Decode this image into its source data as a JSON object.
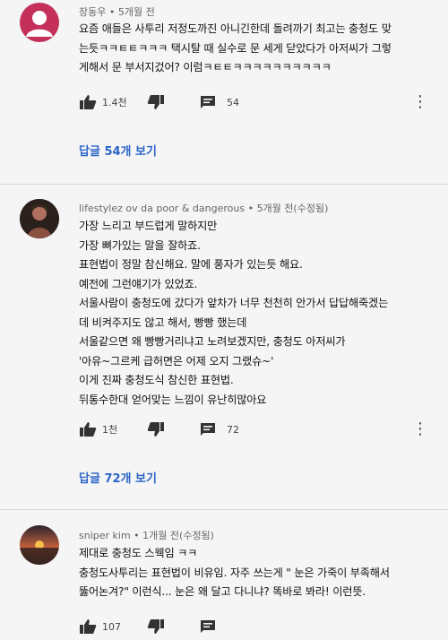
{
  "comments": [
    {
      "author": "장동우",
      "separator": "•",
      "time": "5개월 전",
      "lines": [
        "요즘 애들은 사투리 저정도까진 아니긴한데 돌려까기 최고는 충청도 맞",
        "는듯ㅋㅋㅌㅌㅋㅋㅋ 택시탈 때 실수로 문 세게 닫았다가 아저씨가 그렇",
        "게해서 문 부서지겄어? 이럼ㅋㅌㅌㅋㅋㅋㅋㅋㅋㅋㅋㅋㅋ"
      ],
      "likes": "1.4천",
      "reply_count": "54",
      "replies_link": "답글 54개 보기",
      "avatar_color": "#c4305a"
    },
    {
      "author": "lifestylez ov da poor & dangerous",
      "separator": "•",
      "time": "5개월 전(수정됨)",
      "lines": [
        "가장 느리고 부드럽게 말하지만",
        "가장 뼈가있는 말을 잘하죠.",
        "표현법이 정말 참신해요. 말에 풍자가 있는듯 해요.",
        "예전에 그런얘기가 있었죠.",
        "서울사람이 충청도에 갔다가 앞차가 너무 천천히 안가서 답답해죽겠는",
        "데 비켜주지도 않고 해서, 빵빵 했는데",
        "서울같으면 왜 빵빵거리냐고 노려보겠지만, 충청도 아저씨가",
        "'아유~그르케 급허면은 어제 오지 그랬슈~'",
        "이게 진짜 충청도식 참신한 표현법.",
        "뒤통수한대 얻어맞는 느낌이 유난히많아요"
      ],
      "likes": "1천",
      "reply_count": "72",
      "replies_link": "답글 72개 보기"
    },
    {
      "author": "sniper kim",
      "separator": "•",
      "time": "1개월 전(수정됨)",
      "lines": [
        "제대로 충청도 스웩임 ㅋㅋ",
        "충청도사투리는 표현법이 비유임. 자주 쓰는게 \" 눈은 가죽이 부족해서",
        "뚫어논겨?\" 이런식... 눈은 왜 달고 다니냐? 똑바로 봐라! 이런뜻."
      ],
      "likes": "107"
    }
  ],
  "icons": {
    "like": "thumbs-up-icon",
    "dislike": "thumbs-down-icon",
    "reply": "reply-icon",
    "more": "more-vertical-icon"
  },
  "more_glyph": "⋮",
  "colors": {
    "background": "#f5f5f5",
    "link": "#2a64c8",
    "meta_text": "#666666",
    "divider": "#d9d9d9"
  }
}
